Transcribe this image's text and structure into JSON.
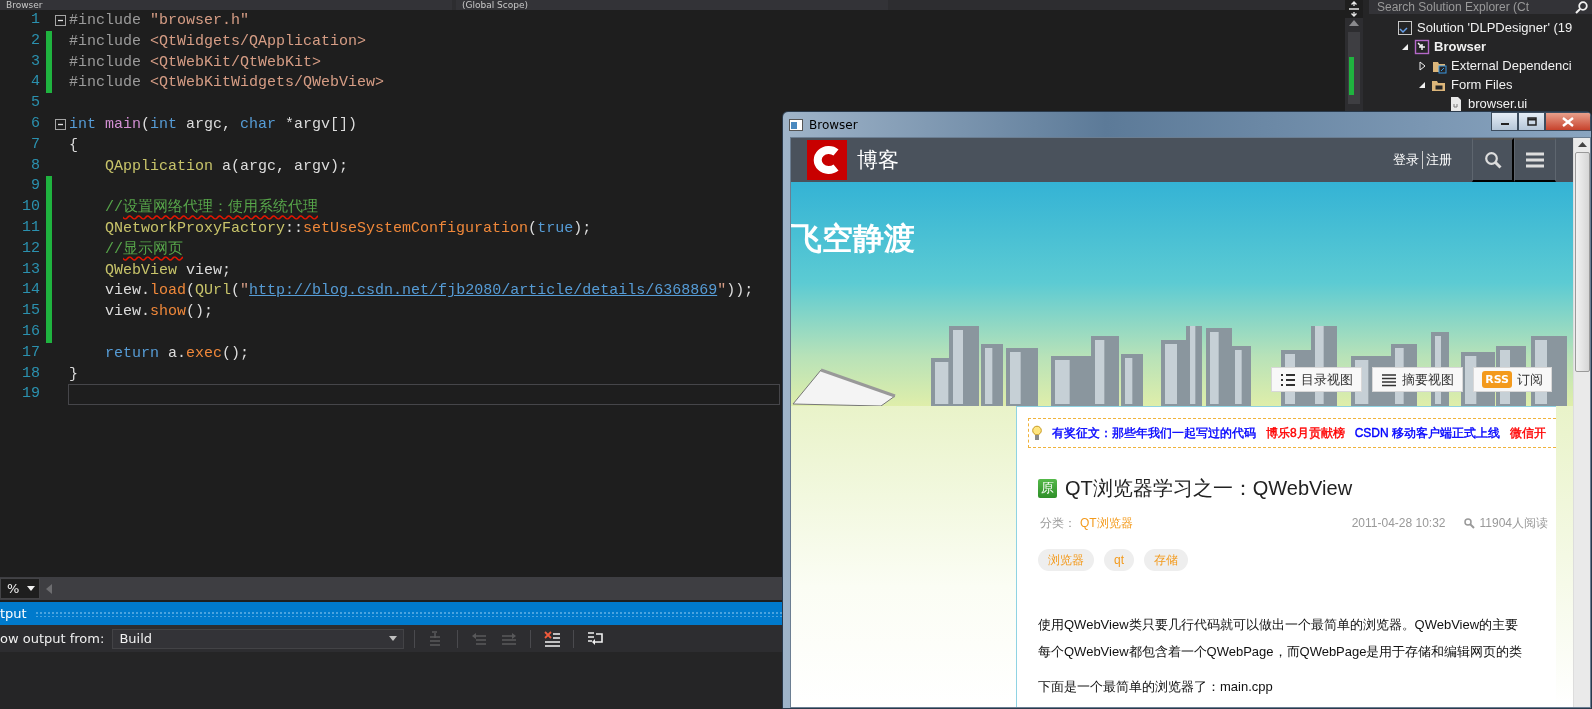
{
  "editor": {
    "navigation": [
      {
        "text": "Browser"
      },
      {
        "text": "(Global Scope)"
      }
    ],
    "lines": [
      {
        "number": "1",
        "changed": false,
        "collapsible": true,
        "current": false,
        "tokens": [
          {
            "kind": "pre",
            "text": "#include "
          },
          {
            "kind": "str",
            "text": "\"browser.h\""
          }
        ]
      },
      {
        "number": "2",
        "changed": true,
        "collapsible": false,
        "current": false,
        "tokens": [
          {
            "kind": "pre",
            "text": "#include "
          },
          {
            "kind": "str",
            "text": "<QtWidgets/QApplication>"
          }
        ]
      },
      {
        "number": "3",
        "changed": true,
        "collapsible": false,
        "current": false,
        "tokens": [
          {
            "kind": "pre",
            "text": "#include "
          },
          {
            "kind": "str",
            "text": "<QtWebKit/QtWebKit>"
          }
        ]
      },
      {
        "number": "4",
        "changed": true,
        "collapsible": false,
        "current": false,
        "tokens": [
          {
            "kind": "pre",
            "text": "#include "
          },
          {
            "kind": "str",
            "text": "<QtWebKitWidgets/QWebView>"
          }
        ]
      },
      {
        "number": "5",
        "changed": false,
        "collapsible": false,
        "current": false
      },
      {
        "number": "6",
        "changed": false,
        "collapsible": true,
        "current": false,
        "tokens": [
          {
            "kind": "kw",
            "text": "int "
          },
          {
            "kind": "fn",
            "text": "main"
          },
          {
            "kind": "plain",
            "text": "("
          },
          {
            "kind": "kw",
            "text": "int"
          },
          {
            "kind": "plain",
            "text": " argc, "
          },
          {
            "kind": "kw",
            "text": "char"
          },
          {
            "kind": "plain",
            "text": " *argv[])"
          }
        ]
      },
      {
        "number": "7",
        "changed": false,
        "collapsible": false,
        "current": false,
        "tokens": [
          {
            "kind": "plain",
            "text": "{"
          }
        ]
      },
      {
        "number": "8",
        "changed": false,
        "collapsible": false,
        "current": false,
        "tokens": [
          {
            "kind": "type",
            "text": "    QApplication"
          },
          {
            "kind": "plain",
            "text": " a(argc, argv);"
          }
        ]
      },
      {
        "number": "9",
        "changed": true,
        "collapsible": false,
        "current": false
      },
      {
        "number": "10",
        "changed": true,
        "collapsible": false,
        "current": false,
        "tokens": [
          {
            "kind": "comment",
            "text": "    //"
          },
          {
            "kind": "comment",
            "text": "设置网络代理：使用系统代理",
            "squiggle": true
          }
        ]
      },
      {
        "number": "11",
        "changed": true,
        "collapsible": false,
        "current": false,
        "tokens": [
          {
            "kind": "type",
            "text": "    QNetworkProxyFactory"
          },
          {
            "kind": "plain",
            "text": "::"
          },
          {
            "kind": "method",
            "text": "setUseSystemConfiguration"
          },
          {
            "kind": "plain",
            "text": "("
          },
          {
            "kind": "kw",
            "text": "true"
          },
          {
            "kind": "plain",
            "text": ");"
          }
        ]
      },
      {
        "number": "12",
        "changed": true,
        "collapsible": false,
        "current": false,
        "tokens": [
          {
            "kind": "comment",
            "text": "    //"
          },
          {
            "kind": "comment",
            "text": "显示网页",
            "squiggle": true
          }
        ]
      },
      {
        "number": "13",
        "changed": true,
        "collapsible": false,
        "current": false,
        "tokens": [
          {
            "kind": "type",
            "text": "    QWebView"
          },
          {
            "kind": "plain",
            "text": " view;"
          }
        ]
      },
      {
        "number": "14",
        "changed": true,
        "collapsible": false,
        "current": false,
        "tokens": [
          {
            "kind": "plain",
            "text": "    view."
          },
          {
            "kind": "method",
            "text": "load"
          },
          {
            "kind": "plain",
            "text": "("
          },
          {
            "kind": "type",
            "text": "QUrl"
          },
          {
            "kind": "plain",
            "text": "("
          },
          {
            "kind": "str",
            "text": "\""
          },
          {
            "kind": "url",
            "text": "http://blog.csdn.net/fjb2080/article/details/6368869"
          },
          {
            "kind": "str",
            "text": "\""
          },
          {
            "kind": "plain",
            "text": "));"
          }
        ]
      },
      {
        "number": "15",
        "changed": true,
        "collapsible": false,
        "current": false,
        "tokens": [
          {
            "kind": "plain",
            "text": "    view."
          },
          {
            "kind": "method",
            "text": "show"
          },
          {
            "kind": "plain",
            "text": "();"
          }
        ]
      },
      {
        "number": "16",
        "changed": true,
        "collapsible": false,
        "current": false
      },
      {
        "number": "17",
        "changed": false,
        "collapsible": false,
        "current": false,
        "tokens": [
          {
            "kind": "kw",
            "text": "    return"
          },
          {
            "kind": "plain",
            "text": " a."
          },
          {
            "kind": "method",
            "text": "exec"
          },
          {
            "kind": "plain",
            "text": "();"
          }
        ]
      },
      {
        "number": "18",
        "changed": false,
        "collapsible": false,
        "current": false,
        "tokens": [
          {
            "kind": "plain",
            "text": "}"
          }
        ]
      },
      {
        "number": "19",
        "changed": false,
        "collapsible": false,
        "current": true
      }
    ],
    "zoom": "%"
  },
  "output": {
    "title": "tput",
    "source_label": "ow output from:",
    "source": "Build",
    "tools": [
      {
        "kind": "goto",
        "disabled": true
      },
      {
        "kind": "prev",
        "disabled": true
      },
      {
        "kind": "next",
        "disabled": true
      },
      {
        "kind": "clear",
        "disabled": false
      },
      {
        "kind": "wrap",
        "disabled": false
      }
    ]
  },
  "solution_explorer": {
    "search": {
      "placeholder": "Search Solution Explorer (Ct"
    },
    "tree": [
      {
        "kind": "solution",
        "label": "Solution 'DLPDesigner' (19",
        "children": [
          {
            "kind": "project",
            "label": "Browser",
            "expanded": true,
            "children": [
              {
                "kind": "references",
                "label": "External Dependenci",
                "expanded": false
              },
              {
                "kind": "filter",
                "label": "Form Files",
                "expanded": true,
                "children": [
                  {
                    "kind": "ui_file",
                    "label": "browser.ui"
                  }
                ]
              }
            ]
          }
        ]
      }
    ]
  },
  "browser_window": {
    "title": "Browser",
    "page": {
      "site_name": "博客",
      "account_links": [
        {
          "label": "登录"
        },
        {
          "label": "注册"
        }
      ],
      "blog_title": "飞空静渡",
      "view_buttons": [
        {
          "kind": "list",
          "label": "目录视图"
        },
        {
          "kind": "summary",
          "label": "摘要视图"
        },
        {
          "kind": "rss",
          "badge": "RSS",
          "label": "订阅"
        }
      ],
      "notices": [
        {
          "text": "有奖征文：那些年我们一起写过的代码",
          "color": "#0000ff"
        },
        {
          "text": "博乐8月贡献榜",
          "color": "#ff0000"
        },
        {
          "text": "CSDN 移动客户端正式上线",
          "color": "#0000ff"
        },
        {
          "text": "微信开",
          "color": "#ff0000"
        }
      ],
      "article": {
        "badge": "原",
        "title": "QT浏览器学习之一：QWebView",
        "category_label": "分类：",
        "category": "QT浏览器",
        "date": "2011-04-28 10:32",
        "views": "11904人阅读",
        "tags": [
          "浏览器",
          "qt",
          "存储"
        ],
        "paragraph_lines": [
          "使用QWebView类只要几行代码就可以做出一个最简单的浏览器。QWebView的主要",
          "每个QWebView都包含着一个QWebPage，而QWebPage是用于存储和编辑网页的类"
        ],
        "next_line": "下面是一个最简单的浏览器了：main.cpp"
      }
    }
  }
}
